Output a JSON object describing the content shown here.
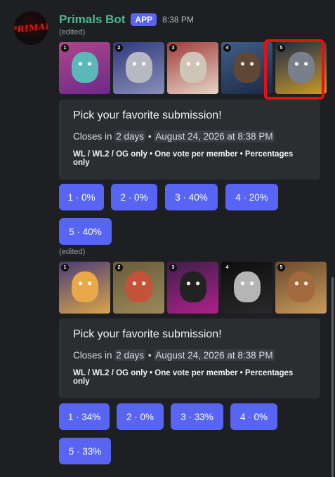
{
  "message": {
    "bot_name": "Primals Bot",
    "badge": "APP",
    "time": "8:38 PM",
    "avatar_logo_text": "PRIMAL",
    "edited_label": "(edited)"
  },
  "polls": [
    {
      "thumbnails": [
        {
          "num": "1",
          "bg": "#b0458a",
          "face": "#5ab9b8"
        },
        {
          "num": "2",
          "bg": "#2d3a7c",
          "face": "#b8b8c2"
        },
        {
          "num": "3",
          "bg": "#a23b3b",
          "face": "#cfc5b7"
        },
        {
          "num": "4",
          "bg": "#3f5f8a",
          "face": "#5e4734"
        },
        {
          "num": "5",
          "bg": "#1e2a47",
          "face": "#7a7f8c"
        }
      ],
      "title": "Pick your favorite submission!",
      "closes_prefix": "Closes in ",
      "closes_in": "2 days",
      "closes_sep": " • ",
      "closes_date": "August 24, 2026 at 8:38 PM",
      "rules": "WL / WL2 / OG only • One vote per member • Percentages only",
      "buttons": [
        "1 · 0%",
        "2 · 0%",
        "3 · 40%",
        "4 · 20%",
        "5 · 40%"
      ]
    },
    {
      "thumbnails": [
        {
          "num": "1",
          "bg": "#4a3b7a",
          "face": "#e9a94a"
        },
        {
          "num": "2",
          "bg": "#6a5b3c",
          "face": "#c3543b"
        },
        {
          "num": "3",
          "bg": "#3d1f4a",
          "face": "#222222"
        },
        {
          "num": "4",
          "bg": "#0d0d0d",
          "face": "#b5b5b5"
        },
        {
          "num": "5",
          "bg": "#6b4b2e",
          "face": "#a36a3e"
        }
      ],
      "title": "Pick your favorite submission!",
      "closes_prefix": "Closes in ",
      "closes_in": "2 days",
      "closes_sep": " • ",
      "closes_date": "August 24, 2026 at 8:38 PM",
      "rules": "WL / WL2 / OG only • One vote per member • Percentages only",
      "buttons": [
        "1 · 34%",
        "2 · 0%",
        "3 · 33%",
        "4 · 0%",
        "5 · 33%"
      ]
    }
  ],
  "colors": {
    "accent": "#5865f2",
    "bot_name": "#4fb98f",
    "highlight": "#e31212",
    "embed_bg": "#2b2d31",
    "background": "#1e1f22"
  }
}
